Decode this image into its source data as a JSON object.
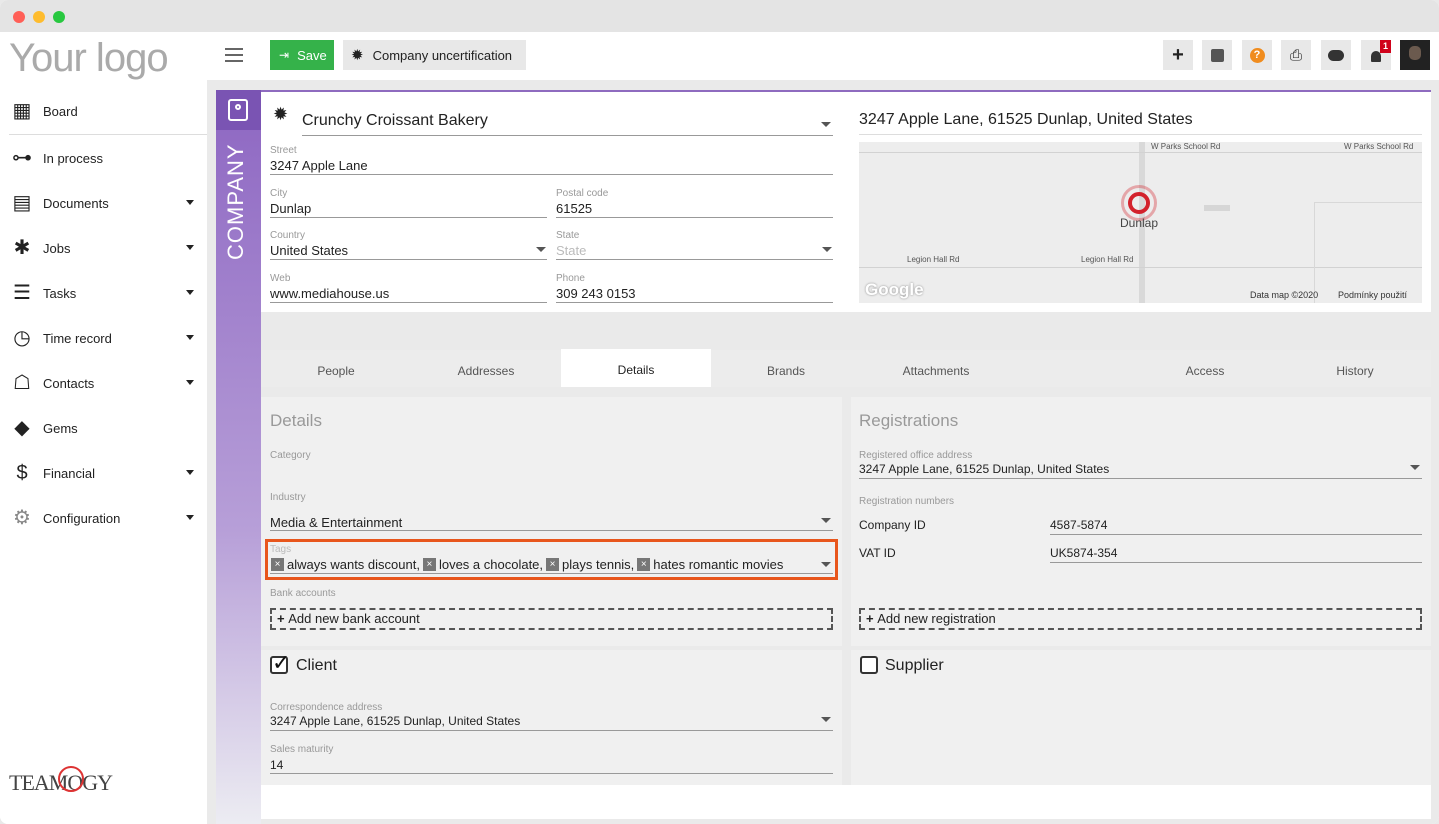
{
  "app": {
    "logo_text": "Your logo",
    "footer_logo": "TEAMOGY"
  },
  "sidebar": {
    "items": [
      {
        "label": "Board",
        "icon": "grid-icon",
        "chevron": false
      },
      {
        "label": "In process",
        "icon": "workflow-icon",
        "chevron": false
      },
      {
        "label": "Documents",
        "icon": "document-icon",
        "chevron": true
      },
      {
        "label": "Jobs",
        "icon": "jobs-icon",
        "chevron": true
      },
      {
        "label": "Tasks",
        "icon": "tasks-icon",
        "chevron": true
      },
      {
        "label": "Time record",
        "icon": "clock-icon",
        "chevron": true
      },
      {
        "label": "Contacts",
        "icon": "contacts-icon",
        "chevron": true
      },
      {
        "label": "Gems",
        "icon": "gem-icon",
        "chevron": false
      },
      {
        "label": "Financial",
        "icon": "dollar-icon",
        "chevron": true
      },
      {
        "label": "Configuration",
        "icon": "gear-icon",
        "chevron": true
      }
    ]
  },
  "toolbar": {
    "save_label": "Save",
    "uncert_label": "Company uncertification",
    "notifications_count": "1"
  },
  "company": {
    "section_label": "COMPANY",
    "name": "Crunchy Croissant Bakery",
    "street_label": "Street",
    "street": "3247  Apple Lane",
    "city_label": "City",
    "city": "Dunlap",
    "postal_label": "Postal code",
    "postal": "61525",
    "country_label": "Country",
    "country": "United States",
    "state_label": "State",
    "state": "State",
    "web_label": "Web",
    "web": "www.mediahouse.us",
    "phone_label": "Phone",
    "phone": "309 243 0153",
    "full_address": "3247 Apple Lane, 61525 Dunlap, United States"
  },
  "map": {
    "road1": "W Parks School Rd",
    "road2": "W Parks School Rd",
    "road3": "Legion Hall Rd",
    "road4": "Legion Hall Rd",
    "place": "Dunlap",
    "brand": "Google",
    "copyright": "Data map ©2020",
    "terms": "Podmínky použití"
  },
  "tabs": [
    "People",
    "Addresses",
    "Details",
    "Brands",
    "Attachments",
    "Access",
    "History"
  ],
  "details": {
    "title": "Details",
    "category_label": "Category",
    "industry_label": "Industry",
    "industry": "Media & Entertainment",
    "tags_label": "Tags",
    "tags": [
      "always wants discount,",
      "loves a chocolate,",
      "plays tennis,",
      "hates romantic movies"
    ],
    "bank_label": "Bank accounts",
    "add_bank": "Add new bank account"
  },
  "registrations": {
    "title": "Registrations",
    "office_label": "Registered office address",
    "office": "3247 Apple Lane, 61525 Dunlap, United States",
    "numbers_label": "Registration numbers",
    "company_id_label": "Company ID",
    "company_id": "4587-5874",
    "vat_label": "VAT ID",
    "vat": "UK5874-354",
    "add_reg": "Add new registration"
  },
  "client": {
    "label": "Client",
    "checked": true,
    "corr_label": "Correspondence address",
    "corr": "3247 Apple Lane, 61525 Dunlap, United States",
    "sales_label": "Sales maturity",
    "sales": "14"
  },
  "supplier": {
    "label": "Supplier",
    "checked": false
  },
  "colors": {
    "accent": "#8e6bbf",
    "save": "#35b24a",
    "highlight": "#e8561c",
    "help": "#f08c1e",
    "badge": "#d0021b"
  }
}
